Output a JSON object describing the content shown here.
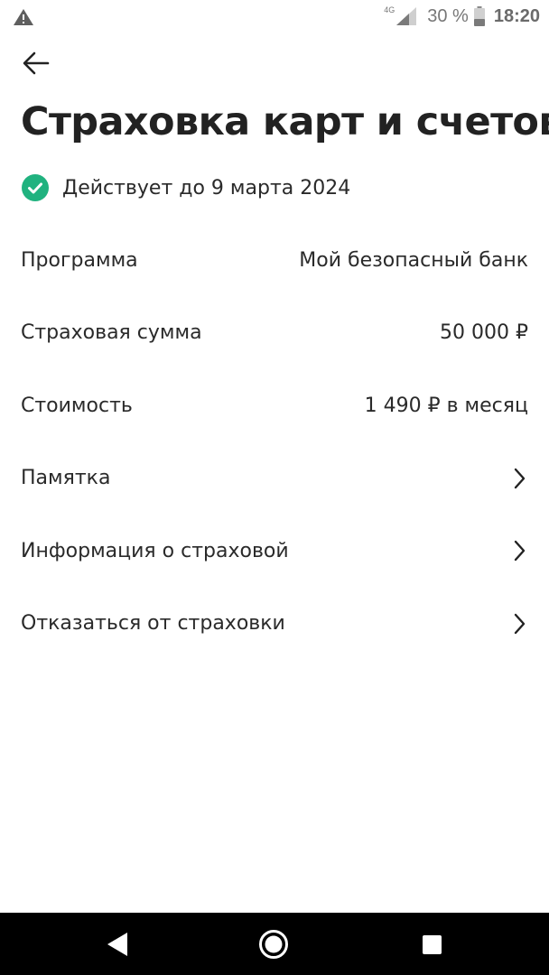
{
  "status_bar": {
    "network": "4G",
    "battery_percent": "30 %",
    "time": "18:20"
  },
  "header": {
    "title": "Страховка карт и счетов"
  },
  "validity": {
    "text": "Действует до 9 марта 2024",
    "status_color": "#20b27f"
  },
  "details": [
    {
      "label": "Программа",
      "value": "Мой безопасный банк"
    },
    {
      "label": "Страховая сумма",
      "value": "50 000 ₽"
    },
    {
      "label": "Стоимость",
      "value": "1 490 ₽ в месяц"
    }
  ],
  "links": [
    {
      "label": "Памятка"
    },
    {
      "label": "Информация о страховой"
    },
    {
      "label": "Отказаться от страховки"
    }
  ],
  "icons": {
    "status_warning": "warning-icon",
    "signal": "signal-icon",
    "battery": "battery-icon",
    "back": "arrow-left-icon",
    "validity": "check-circle-icon",
    "link_chevron": "chevron-right-icon",
    "nav_back": "nav-back-icon",
    "nav_home": "nav-home-icon",
    "nav_recents": "nav-recents-icon"
  }
}
